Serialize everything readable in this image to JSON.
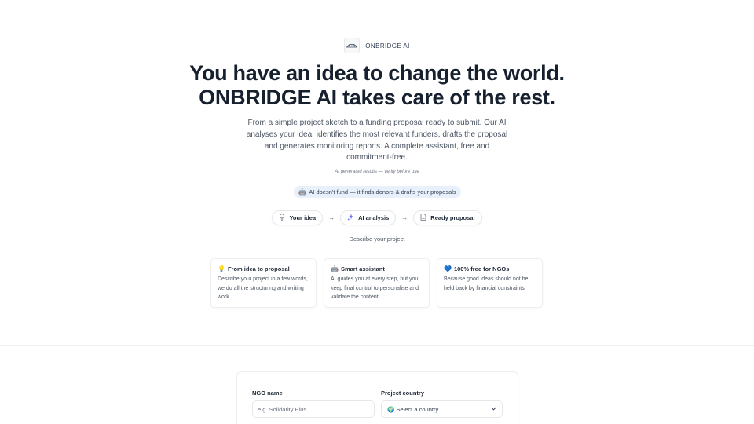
{
  "brand": {
    "name": "ONBRIDGE AI",
    "logo_icon": "bridge-logo-icon"
  },
  "hero": {
    "title_line1": "You have an idea to change the world.",
    "title_line2": "ONBRIDGE AI takes care of the rest.",
    "description": "From a simple project sketch to a funding proposal ready to submit. Our AI analyses your idea, identifies the most relevant funders, drafts the proposal and generates monitoring reports. A complete assistant, free and commitment-free.",
    "disclaimer": "AI generated results — verify before use",
    "info_pill_icon": "🤖",
    "info_pill": "AI doesn't fund — it finds donors & drafts your proposals"
  },
  "steps": [
    {
      "label": "Your idea",
      "icon": "lightbulb-icon"
    },
    {
      "label": "AI analysis",
      "icon": "sparkle-icon"
    },
    {
      "label": "Ready proposal",
      "icon": "document-icon"
    }
  ],
  "describe_label": "Describe your project",
  "features": [
    {
      "emoji": "💡",
      "title": "From idea to proposal",
      "text": "Describe your project in a few words, we do all the structuring and writing work."
    },
    {
      "emoji": "🤖",
      "title": "Smart assistant",
      "text": "AI guides you at every step, but you keep final control to personalise and validate the content."
    },
    {
      "emoji": "💙",
      "title": "100% free for NGOs",
      "text": "Because good ideas should not be held back by financial constraints."
    }
  ],
  "form": {
    "ngo_name_label": "NGO name",
    "ngo_name_placeholder": "e.g. Solidarity Plus",
    "ngo_name_value": "",
    "country_label": "Project country",
    "country_selected": "🌍 Select a country"
  },
  "colors": {
    "title": "#16202e",
    "pill_bg": "#e8f1fb",
    "border": "#e5e7eb"
  }
}
